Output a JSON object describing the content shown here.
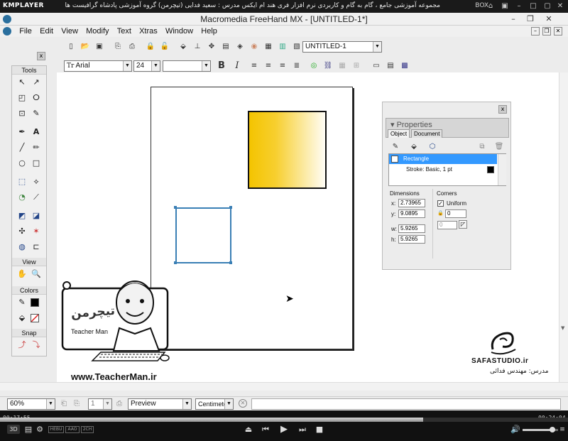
{
  "player": {
    "logo": "KMPLAYER",
    "title": "مجموعه آموزشی جامع ، گام به گام و کاربردی نرم افزار فری هند ام ایکس   مدرس : سعید فدایی (تیچرمن) گروه آموزشی پادشاه گرافیست ها",
    "box_label": "BOX",
    "time_elapsed": "00:17:55",
    "time_total": "00:24:04",
    "badges": [
      "3D",
      "HEBU",
      "AAO",
      "2CH"
    ]
  },
  "window": {
    "title": "Macromedia FreeHand MX - [UNTITLED-1*]"
  },
  "menu": [
    "File",
    "Edit",
    "View",
    "Modify",
    "Text",
    "Xtras",
    "Window",
    "Help"
  ],
  "toolbar": {
    "doc_combo": "UNTITLED-1",
    "font_name": "Arial",
    "font_size": "24",
    "font_style": ""
  },
  "tools_panel": {
    "title": "Tools",
    "view_title": "View",
    "colors_title": "Colors",
    "snap_title": "Snap",
    "close": "x"
  },
  "properties": {
    "title": "Properties",
    "tabs": [
      "Object",
      "Document"
    ],
    "close": "x",
    "list": [
      {
        "label": "Rectangle"
      },
      {
        "label": "Stroke: Basic, 1 pt"
      }
    ],
    "dimensions_label": "Dimensions",
    "x_label": "x:",
    "x_value": "2.73965",
    "y_label": "y:",
    "y_value": "9.0895",
    "w_label": "w:",
    "w_value": "5.9265",
    "h_label": "h:",
    "h_value": "5.9265",
    "corners_label": "Corners",
    "uniform_label": "Uniform",
    "corner_value": "0",
    "corner_value_2": "0"
  },
  "status": {
    "zoom": "60%",
    "page_num": "1",
    "view_mode": "Preview",
    "units": "Centimeters"
  },
  "watermark": {
    "teacherman_logo": "تیچرمن",
    "teacherman_sub": "Teacher Man",
    "url": "www.TeacherMan.ir",
    "safa": "SAFASTUDIO.ir",
    "safa_teacher": "مدرس: مهندس فدائی"
  },
  "colors": {
    "accent": "#3a7fb5",
    "gradient_start": "#f4c400",
    "gradient_end": "#fffdf6",
    "selection_row": "#3399ff"
  }
}
